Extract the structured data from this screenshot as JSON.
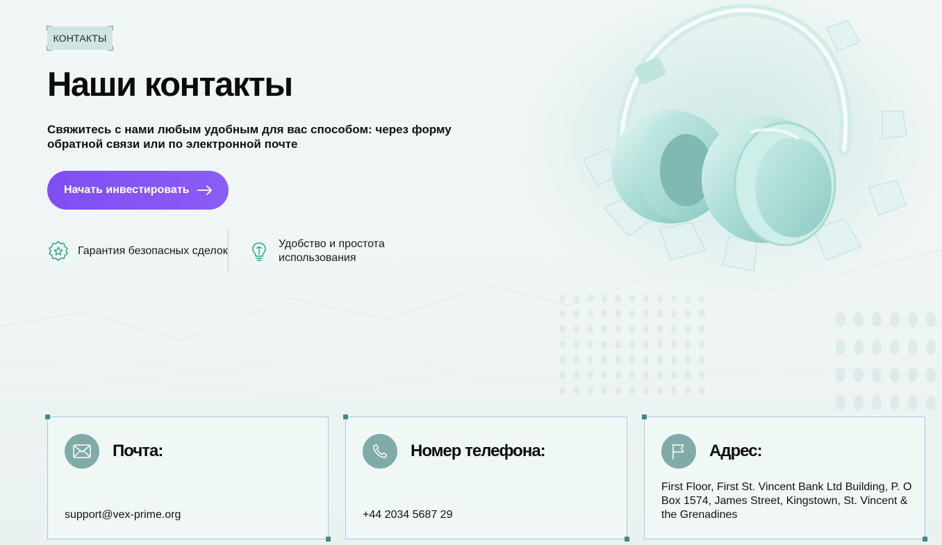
{
  "badge": "КОНТАКТЫ",
  "title": "Наши контакты",
  "subtitle": "Свяжитесь с нами любым удобным для вас способом: через форму обратной связи или по электронной почте",
  "cta_label": "Начать инвестировать",
  "features": [
    {
      "icon": "star-badge-icon",
      "text": "Гарантия безопасных сделок"
    },
    {
      "icon": "lightbulb-icon",
      "text": "Удобство и простота использования"
    }
  ],
  "cards": [
    {
      "icon": "mail-icon",
      "title": "Почта:",
      "value": "support@vex-prime.org"
    },
    {
      "icon": "phone-icon",
      "title": "Номер телефона:",
      "value": "+44 2034 5687 29"
    },
    {
      "icon": "flag-icon",
      "title": "Адрес:",
      "value": "First Floor, First St. Vincent Bank Ltd Building, P. O Box 1574, James Street, Kingstown, St. Vincent & the Grenadines"
    }
  ],
  "colors": {
    "accent": "#8b5cf6",
    "teal": "#80aba7",
    "background": "#eff5f4",
    "card_border": "#a9c6de"
  }
}
